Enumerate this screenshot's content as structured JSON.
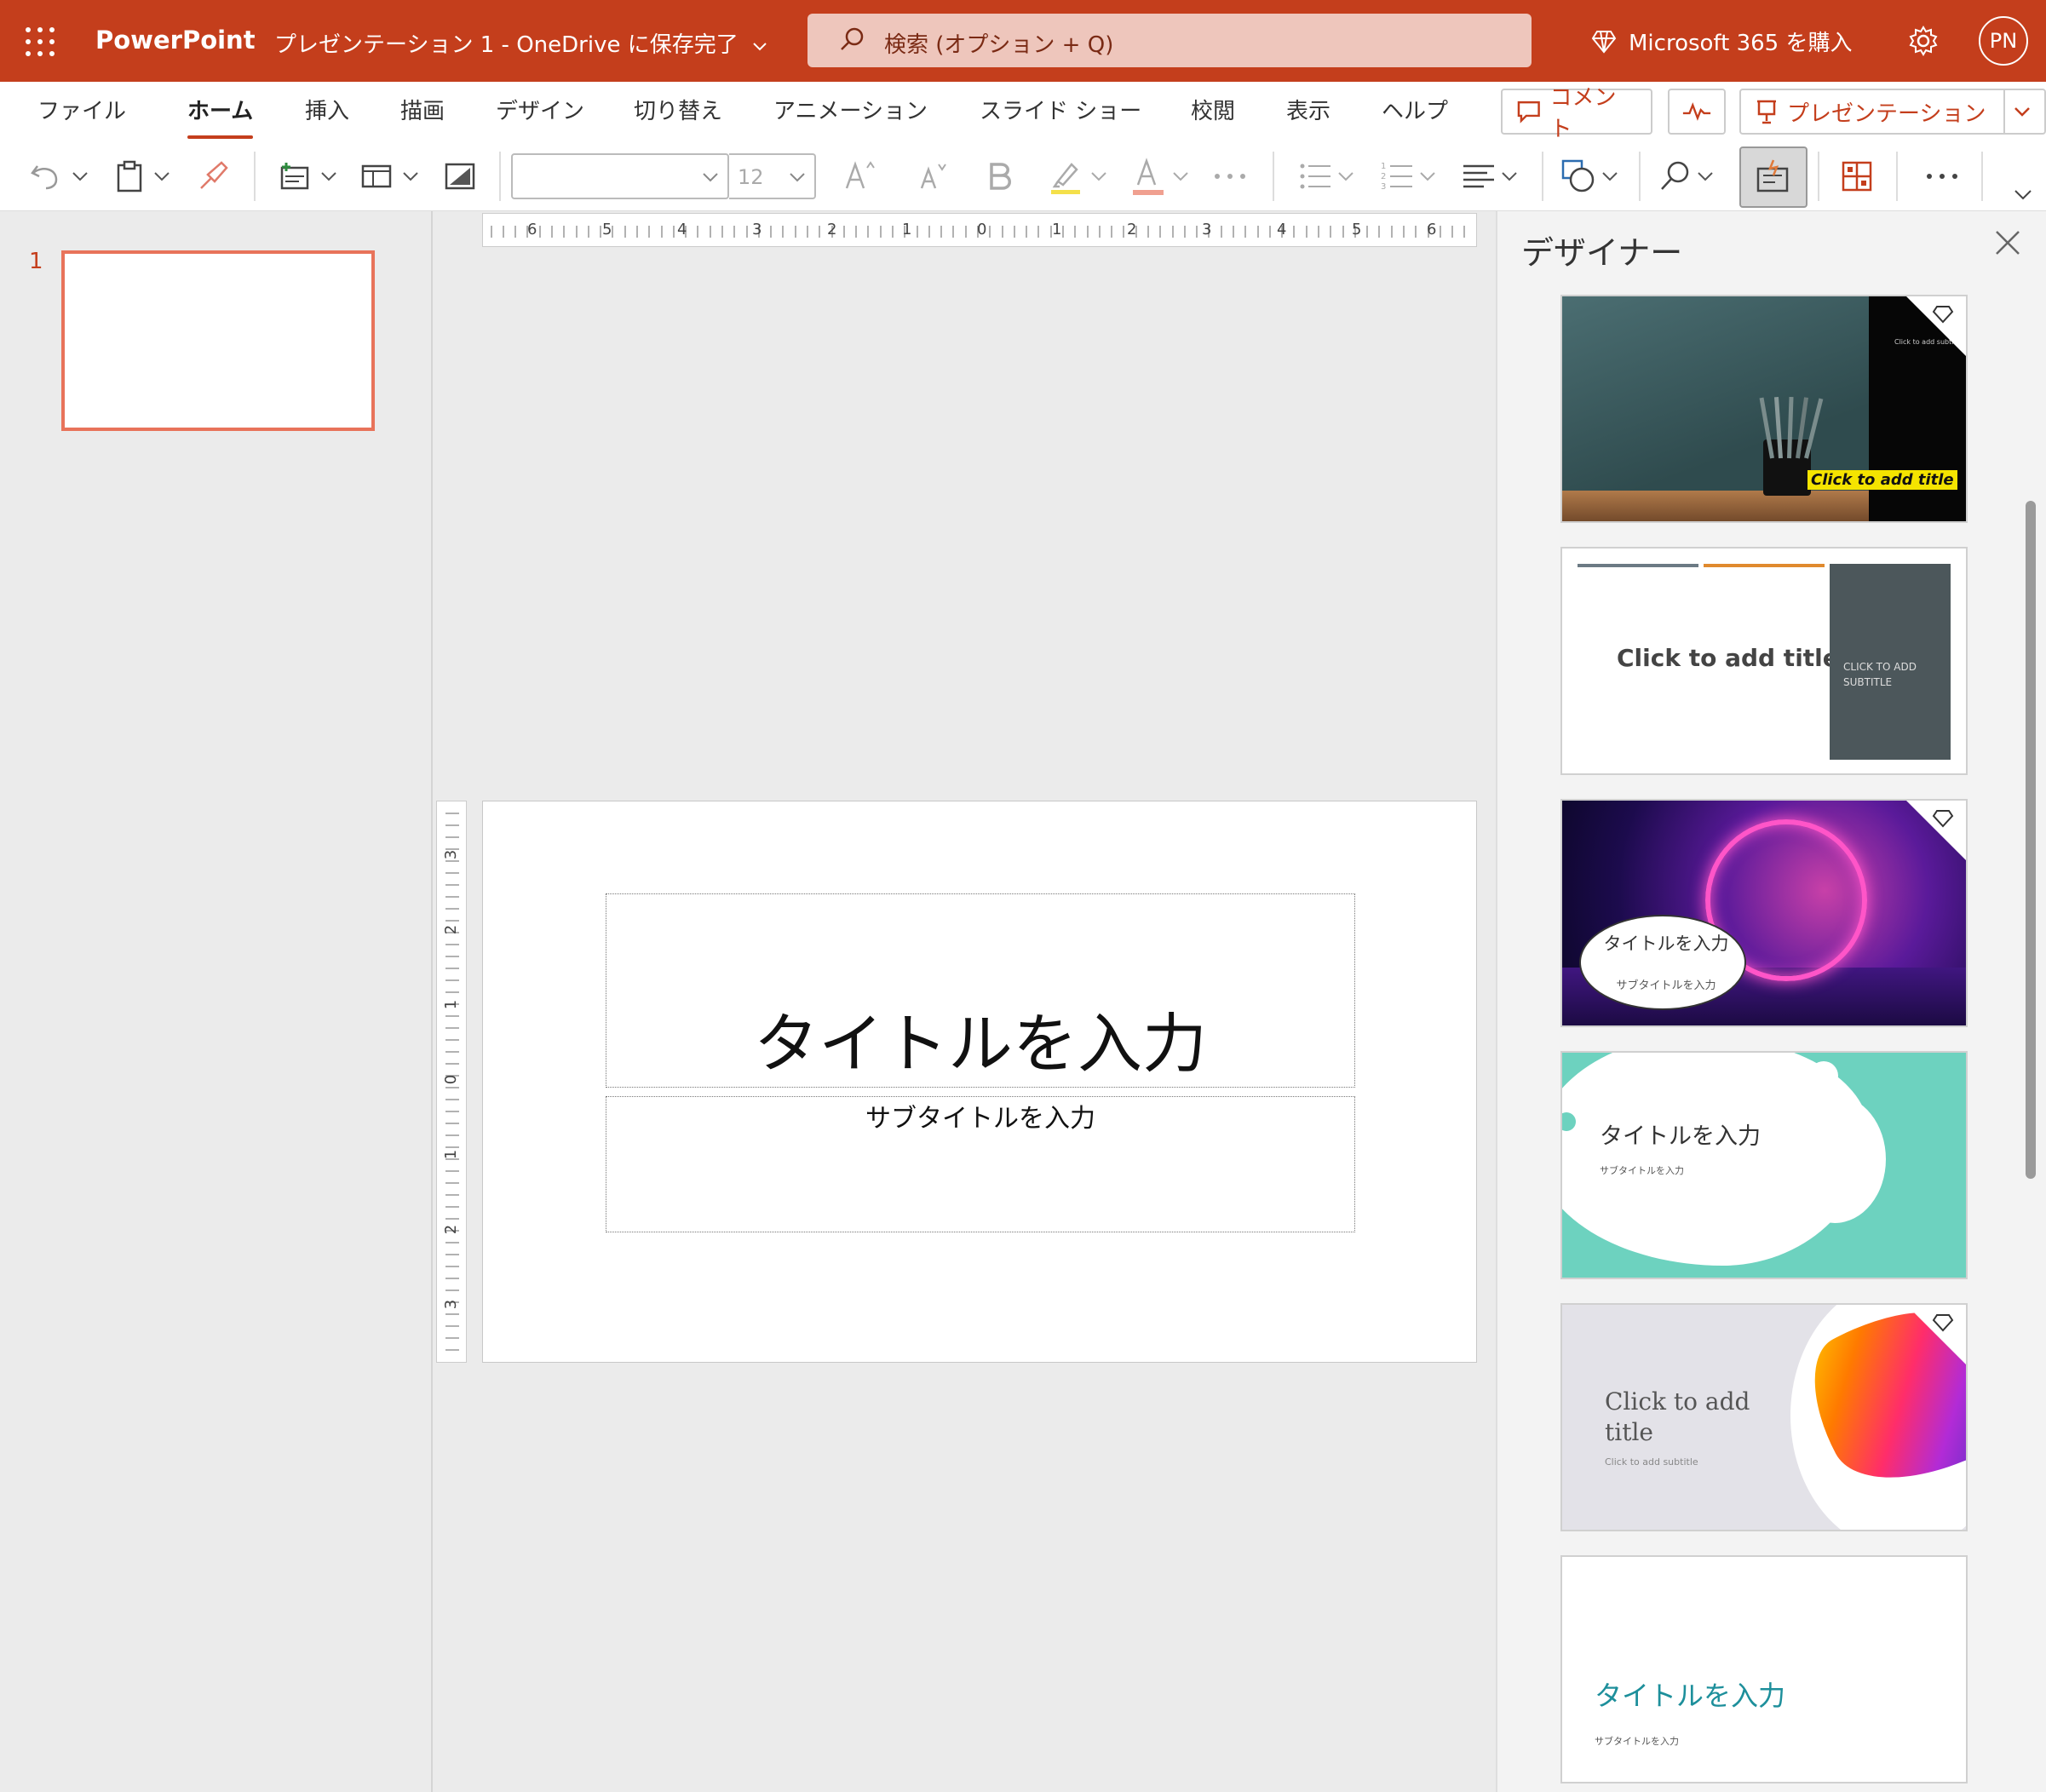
{
  "titlebar": {
    "app_name": "PowerPoint",
    "doc_title": "プレゼンテーション 1 - OneDrive に保存完了",
    "search_placeholder": "検索 (オプション + Q)",
    "m365_label": "Microsoft 365 を購入",
    "avatar_initials": "PN",
    "bg_color": "#c43e1c"
  },
  "ribbon": {
    "tabs": [
      "ファイル",
      "ホーム",
      "挿入",
      "描画",
      "デザイン",
      "切り替え",
      "アニメーション",
      "スライド ショー",
      "校閲",
      "表示",
      "ヘルプ"
    ],
    "active_tab": "ホーム",
    "comment_label": "コメント",
    "present_label": "プレゼンテーション",
    "font_size": "12"
  },
  "slide_panel": {
    "slide_number": "1"
  },
  "ruler": {
    "h_labels": [
      "6",
      "5",
      "4",
      "3",
      "2",
      "1",
      "0",
      "1",
      "2",
      "3",
      "4",
      "5",
      "6"
    ],
    "v_labels": [
      "3",
      "2",
      "1",
      "0",
      "1",
      "2",
      "3"
    ]
  },
  "slide": {
    "title_placeholder": "タイトルを入力",
    "subtitle_placeholder": "サブタイトルを入力"
  },
  "designer": {
    "heading": "デザイナー",
    "cards": [
      {
        "title": "Click to add title",
        "subtitle": "Click to add subtitle",
        "premium": true
      },
      {
        "title": "Click to add title",
        "subtitle": "CLICK TO ADD SUBTITLE",
        "premium": false
      },
      {
        "title": "タイトルを入力",
        "subtitle": "サブタイトルを入力",
        "premium": true
      },
      {
        "title": "タイトルを入力",
        "subtitle": "サブタイトルを入力",
        "premium": false
      },
      {
        "title": "Click to add title",
        "subtitle": "Click to add subtitle",
        "premium": true
      },
      {
        "title": "タイトルを入力",
        "subtitle": "サブタイトルを入力",
        "premium": false
      }
    ]
  }
}
